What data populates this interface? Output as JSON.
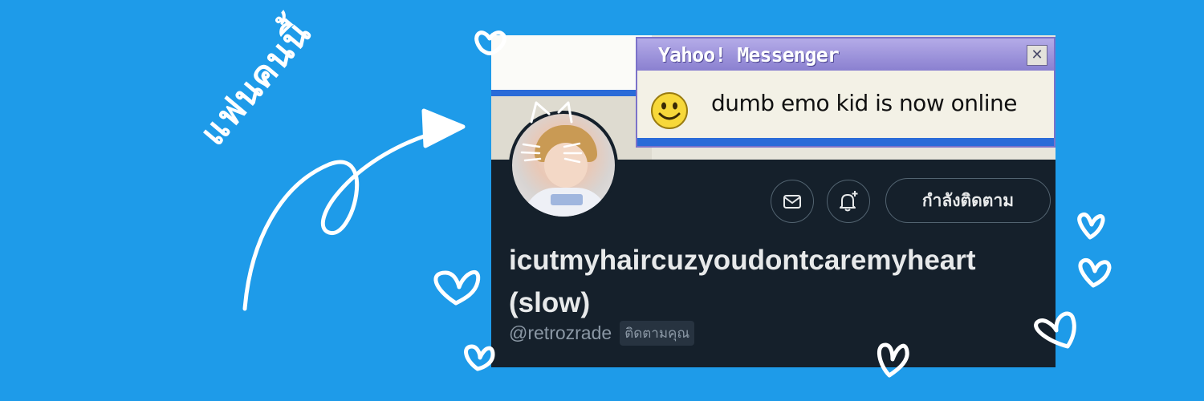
{
  "banner": {
    "background_color": "#1e9be9",
    "handwritten_text": "แฟนคนนี้"
  },
  "popup": {
    "title": "Yahoo! Messenger",
    "close_glyph": "✕",
    "message": "dumb emo kid is now online",
    "icon": "smiley-icon"
  },
  "profile": {
    "display_name": "icutmyhaircuzyoudontcaremyheart (slow)",
    "handle": "@retrozrade",
    "follows_you": "ติดตามคุณ",
    "follow_button_label": "กำลังติดตาม",
    "message_icon": "envelope-icon",
    "notify_icon": "bell-plus-icon",
    "background_color": "#15202b"
  },
  "decorations": [
    "arrow-doodle",
    "heart-doodle",
    "cat-ears-doodle"
  ]
}
